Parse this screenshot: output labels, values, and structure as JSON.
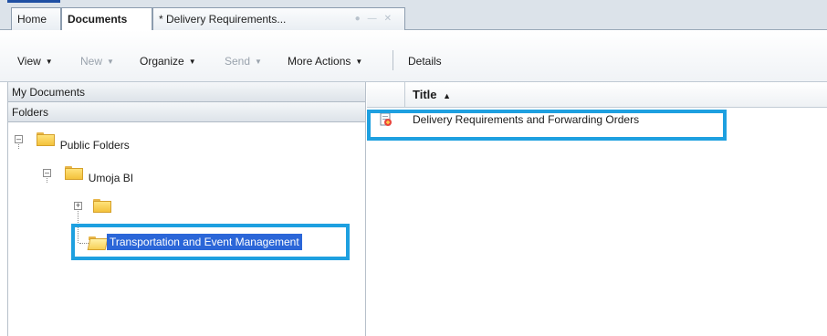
{
  "tabs": {
    "home": "Home",
    "documents": "Documents",
    "delivery": "* Delivery Requirements..."
  },
  "toolbar": {
    "view": "View",
    "new": "New",
    "organize": "Organize",
    "send": "Send",
    "more_actions": "More Actions",
    "details": "Details"
  },
  "left_panel": {
    "my_documents": "My Documents",
    "folders": "Folders",
    "tree": {
      "public_folders": "Public Folders",
      "umoja_bi": "Umoja BI",
      "unnamed_folder": "",
      "selected_folder": "Transportation and Event Management"
    }
  },
  "grid": {
    "column_title": "Title",
    "sort_indicator": "▲",
    "rows": [
      {
        "title": "Delivery Requirements and Forwarding Orders",
        "icon": "webi-report-icon"
      }
    ]
  },
  "colors": {
    "highlight": "#1ea0e0",
    "selection": "#2b66d8"
  }
}
